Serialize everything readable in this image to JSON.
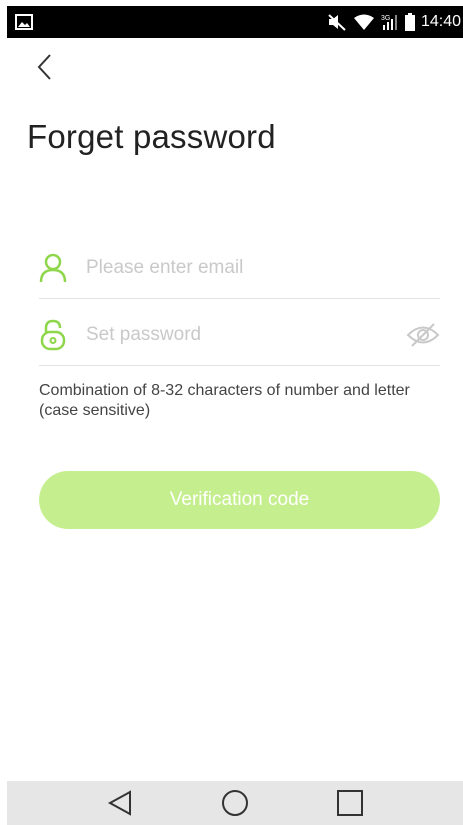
{
  "status_bar": {
    "time": "14:40",
    "icons": [
      "image-icon",
      "mute-icon",
      "wifi-icon",
      "signal-3g-icon",
      "battery-icon"
    ]
  },
  "header": {
    "back_icon": "chevron-left-icon"
  },
  "page": {
    "title": "Forget password"
  },
  "form": {
    "email": {
      "placeholder": "Please enter email",
      "value": "",
      "icon": "user-icon"
    },
    "password": {
      "placeholder": "Set password",
      "value": "",
      "icon": "lock-icon",
      "toggle_icon": "eye-off-icon"
    },
    "hint": "Combination of 8-32 characters of number and letter (case sensitive)",
    "submit_label": "Verification code"
  },
  "nav_bar": {
    "items": [
      "back-triangle-icon",
      "home-circle-icon",
      "recents-square-icon"
    ]
  },
  "colors": {
    "accent": "#8ed64a",
    "button_bg": "#c5ef8e",
    "title": "#222222",
    "placeholder": "#c9c9c9"
  }
}
